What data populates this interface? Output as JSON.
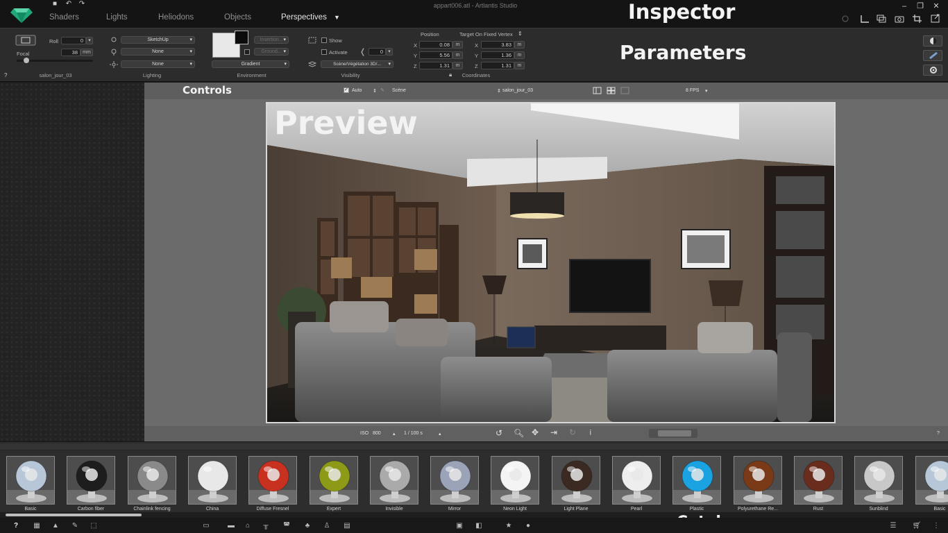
{
  "app": {
    "title": "appart006.atl - Artlantis Studio"
  },
  "tabs": [
    {
      "label": "Shaders",
      "active": false
    },
    {
      "label": "Lights",
      "active": false
    },
    {
      "label": "Heliodons",
      "active": false
    },
    {
      "label": "Objects",
      "active": false
    },
    {
      "label": "Perspectives",
      "active": true
    }
  ],
  "overlays": {
    "inspector": "Inspector",
    "parameters": "Parameters",
    "controls": "Controls",
    "preview": "Preview",
    "catalog": "Catalog"
  },
  "params": {
    "roll_label": "Roll",
    "roll_value": "0",
    "focal_label": "Focal",
    "focal_value": "38",
    "focal_unit": "mm",
    "view_name": "salon_jour_03",
    "lighting": {
      "light1": "SketchUp",
      "light2": "None",
      "light3": "None",
      "section": "Lighting"
    },
    "environment": {
      "insertion": "Insertion...",
      "ground": "Ground...",
      "background": "Gradient",
      "section": "Environment"
    },
    "visibility": {
      "show": "Show",
      "activate": "Activate",
      "angle": "0",
      "scene": "Scène/Végétation 3D/...",
      "section": "Visibility"
    },
    "coordinates": {
      "position_label": "Position",
      "target_label": "Target On Fixed Vertex",
      "pos": {
        "x": "0.08",
        "y": "5.56",
        "z": "1.31"
      },
      "target": {
        "x": "3.83",
        "y": "1.36",
        "z": "1.31"
      },
      "unit": "m",
      "section": "Coordinates"
    },
    "help": "?"
  },
  "controls": {
    "auto": "Auto",
    "scene": "Scène",
    "view": "salon_jour_03",
    "fps": "8 FPS"
  },
  "bottombar": {
    "iso": "ISO",
    "iso_value": "800",
    "shutter": "1 / 100 s",
    "help": "?"
  },
  "catalog": {
    "items": [
      {
        "label": "Basic",
        "color": "#b7c7d8"
      },
      {
        "label": "Carbon fiber",
        "color": "#1d1d1d"
      },
      {
        "label": "Chainlink fencing",
        "color": "#8a8a8a"
      },
      {
        "label": "China",
        "color": "#e8e8e8"
      },
      {
        "label": "Diffuse Fresnel",
        "color": "#c83020"
      },
      {
        "label": "Expert",
        "color": "#8c9a18"
      },
      {
        "label": "Invisible",
        "color": "#aaaaaa"
      },
      {
        "label": "Mirror",
        "color": "#9aa3b8"
      },
      {
        "label": "Neon Light",
        "color": "#f4f4f4"
      },
      {
        "label": "Light Plane",
        "color": "#3a2a22"
      },
      {
        "label": "Pearl",
        "color": "#eeeeee"
      },
      {
        "label": "Plastic",
        "color": "#1ba2e0"
      },
      {
        "label": "Polyurethane Re...",
        "color": "#7a3a18"
      },
      {
        "label": "Rust",
        "color": "#6a2c1c"
      },
      {
        "label": "Sunblind",
        "color": "#c8c8c8"
      },
      {
        "label": "Basic",
        "color": "#b7c7d8"
      }
    ]
  }
}
